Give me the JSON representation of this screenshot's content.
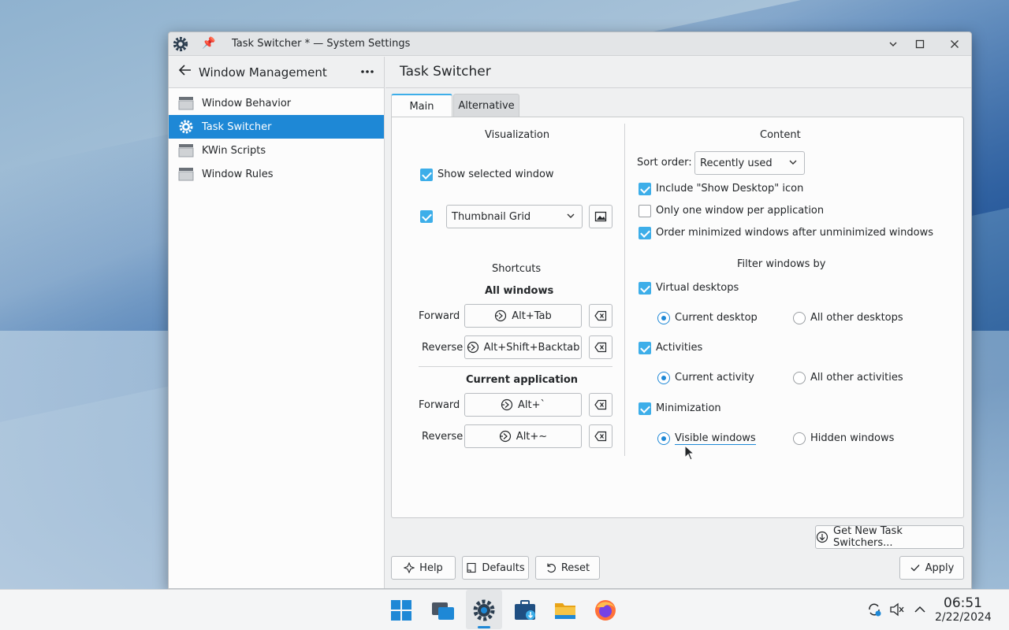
{
  "window": {
    "title": "Task Switcher * — System Settings"
  },
  "sidebar": {
    "header": "Window Management",
    "items": [
      {
        "label": "Window Behavior",
        "active": false
      },
      {
        "label": "Task Switcher",
        "active": true
      },
      {
        "label": "KWin Scripts",
        "active": false
      },
      {
        "label": "Window Rules",
        "active": false
      }
    ]
  },
  "page": {
    "title": "Task Switcher",
    "tabs": [
      "Main",
      "Alternative"
    ]
  },
  "visualization": {
    "heading": "Visualization",
    "show_selected_window": {
      "label": "Show selected window",
      "checked": true
    },
    "layout_enabled": true,
    "layout_value": "Thumbnail Grid"
  },
  "shortcuts": {
    "heading": "Shortcuts",
    "all_windows": {
      "heading": "All windows",
      "forward_label": "Forward",
      "forward_value": "Alt+Tab",
      "reverse_label": "Reverse",
      "reverse_value": "Alt+Shift+Backtab"
    },
    "current_application": {
      "heading": "Current application",
      "forward_label": "Forward",
      "forward_value": "Alt+`",
      "reverse_label": "Reverse",
      "reverse_value": "Alt+~"
    }
  },
  "content": {
    "heading": "Content",
    "sort_order_label": "Sort order:",
    "sort_order_value": "Recently used",
    "include_show_desktop": {
      "label": "Include \"Show Desktop\" icon",
      "checked": true
    },
    "one_window_per_app": {
      "label": "Only one window per application",
      "checked": false
    },
    "order_minimized": {
      "label": "Order minimized windows after unminimized windows",
      "checked": true
    },
    "filter_heading": "Filter windows by",
    "virtual_desktops": {
      "label": "Virtual desktops",
      "checked": true,
      "option_a": "Current desktop",
      "option_b": "All other desktops"
    },
    "activities": {
      "label": "Activities",
      "checked": true,
      "option_a": "Current activity",
      "option_b": "All other activities"
    },
    "minimization": {
      "label": "Minimization",
      "checked": true,
      "option_a": "Visible windows",
      "option_b": "Hidden windows"
    }
  },
  "buttons": {
    "get_new": "Get New Task Switchers...",
    "help": "Help",
    "defaults": "Defaults",
    "reset": "Reset",
    "apply": "Apply"
  },
  "taskbar": {
    "time": "06:51",
    "date": "2/22/2024"
  },
  "colors": {
    "accent": "#1e88d6",
    "checkbox": "#3daee9"
  }
}
